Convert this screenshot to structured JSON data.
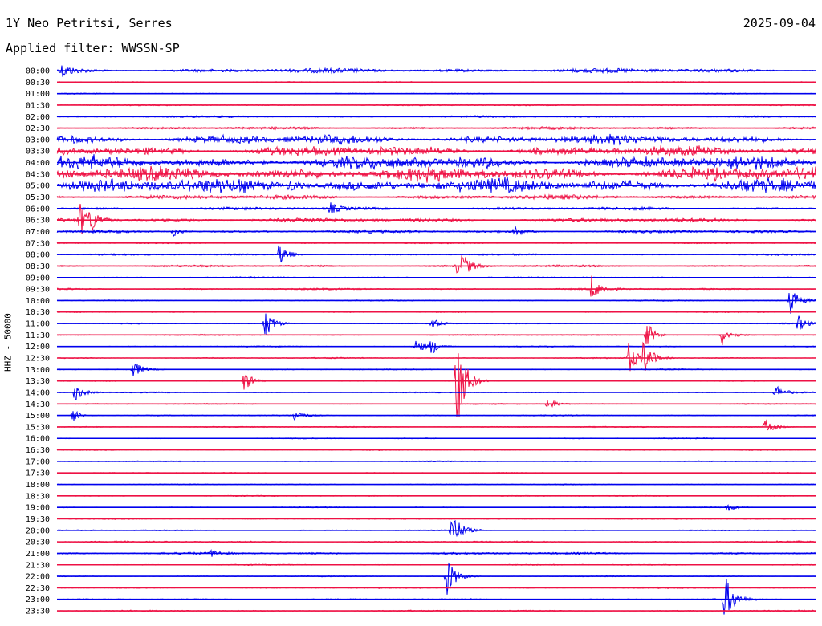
{
  "header": {
    "station": "1Y Neo Petritsi, Serres",
    "date": "2025-09-04",
    "filter": "Applied filter: WWSSN-SP"
  },
  "chart_data": {
    "type": "line",
    "ylabel": "HHZ - 50000",
    "rows": [
      "00:00",
      "00:30",
      "01:00",
      "01:30",
      "02:00",
      "02:30",
      "03:00",
      "03:30",
      "04:00",
      "04:30",
      "05:00",
      "05:30",
      "06:00",
      "06:30",
      "07:00",
      "07:30",
      "08:00",
      "08:30",
      "09:00",
      "09:30",
      "10:00",
      "10:30",
      "11:00",
      "11:30",
      "12:00",
      "12:30",
      "13:00",
      "13:30",
      "14:00",
      "14:30",
      "15:00",
      "15:30",
      "16:00",
      "16:30",
      "17:00",
      "17:30",
      "18:00",
      "18:30",
      "19:00",
      "19:30",
      "20:00",
      "20:30",
      "21:00",
      "21:30",
      "22:00",
      "22:30",
      "23:00",
      "23:30"
    ],
    "colors": [
      "#0000ee",
      "#ee1144"
    ],
    "row_minutes": 30,
    "noise_levels": [
      3.0,
      0.9,
      0.7,
      1.0,
      1.4,
      1.8,
      5.5,
      6.0,
      8.0,
      8.5,
      9.0,
      3.0,
      2.0,
      2.5,
      2.0,
      1.0,
      1.2,
      1.5,
      1.0,
      1.2,
      0.8,
      0.9,
      0.8,
      0.9,
      0.8,
      0.8,
      0.8,
      0.8,
      0.8,
      0.8,
      0.8,
      0.8,
      0.7,
      0.9,
      0.7,
      0.7,
      0.7,
      0.7,
      0.7,
      0.9,
      0.8,
      1.2,
      1.5,
      0.8,
      0.7,
      1.0,
      1.0,
      1.0
    ],
    "events": [
      {
        "row": 0,
        "minute": 0.2,
        "amp": 8
      },
      {
        "row": 10,
        "minute": 9.2,
        "amp": 9
      },
      {
        "row": 12,
        "minute": 10.8,
        "amp": 7
      },
      {
        "row": 13,
        "minute": 0.9,
        "amp": 22
      },
      {
        "row": 13,
        "minute": 1.3,
        "amp": 14
      },
      {
        "row": 14,
        "minute": 4.6,
        "amp": 6
      },
      {
        "row": 14,
        "minute": 18.1,
        "amp": 6
      },
      {
        "row": 16,
        "minute": 8.8,
        "amp": 18
      },
      {
        "row": 17,
        "minute": 15.8,
        "amp": 8
      },
      {
        "row": 17,
        "minute": 16.0,
        "amp": 14
      },
      {
        "row": 19,
        "minute": 21.1,
        "amp": 18
      },
      {
        "row": 20,
        "minute": 29.0,
        "amp": 22
      },
      {
        "row": 22,
        "minute": 8.2,
        "amp": 22
      },
      {
        "row": 22,
        "minute": 14.8,
        "amp": 8
      },
      {
        "row": 22,
        "minute": 29.3,
        "amp": 10
      },
      {
        "row": 23,
        "minute": 23.3,
        "amp": 18
      },
      {
        "row": 23,
        "minute": 26.3,
        "amp": 12
      },
      {
        "row": 24,
        "minute": 14.2,
        "amp": 10
      },
      {
        "row": 24,
        "minute": 14.8,
        "amp": 10
      },
      {
        "row": 25,
        "minute": 22.6,
        "amp": 20
      },
      {
        "row": 25,
        "minute": 23.2,
        "amp": 24
      },
      {
        "row": 26,
        "minute": 3.0,
        "amp": 12
      },
      {
        "row": 27,
        "minute": 7.4,
        "amp": 14
      },
      {
        "row": 27,
        "minute": 15.8,
        "amp": 70
      },
      {
        "row": 28,
        "minute": 0.7,
        "amp": 12
      },
      {
        "row": 28,
        "minute": 28.4,
        "amp": 10
      },
      {
        "row": 29,
        "minute": 19.4,
        "amp": 8
      },
      {
        "row": 30,
        "minute": 0.6,
        "amp": 8
      },
      {
        "row": 30,
        "minute": 9.4,
        "amp": 8
      },
      {
        "row": 31,
        "minute": 28.0,
        "amp": 12
      },
      {
        "row": 38,
        "minute": 26.5,
        "amp": 5
      },
      {
        "row": 40,
        "minute": 15.6,
        "amp": 28
      },
      {
        "row": 42,
        "minute": 6.1,
        "amp": 4
      },
      {
        "row": 44,
        "minute": 15.4,
        "amp": 28
      },
      {
        "row": 46,
        "minute": 26.4,
        "amp": 32
      }
    ]
  }
}
